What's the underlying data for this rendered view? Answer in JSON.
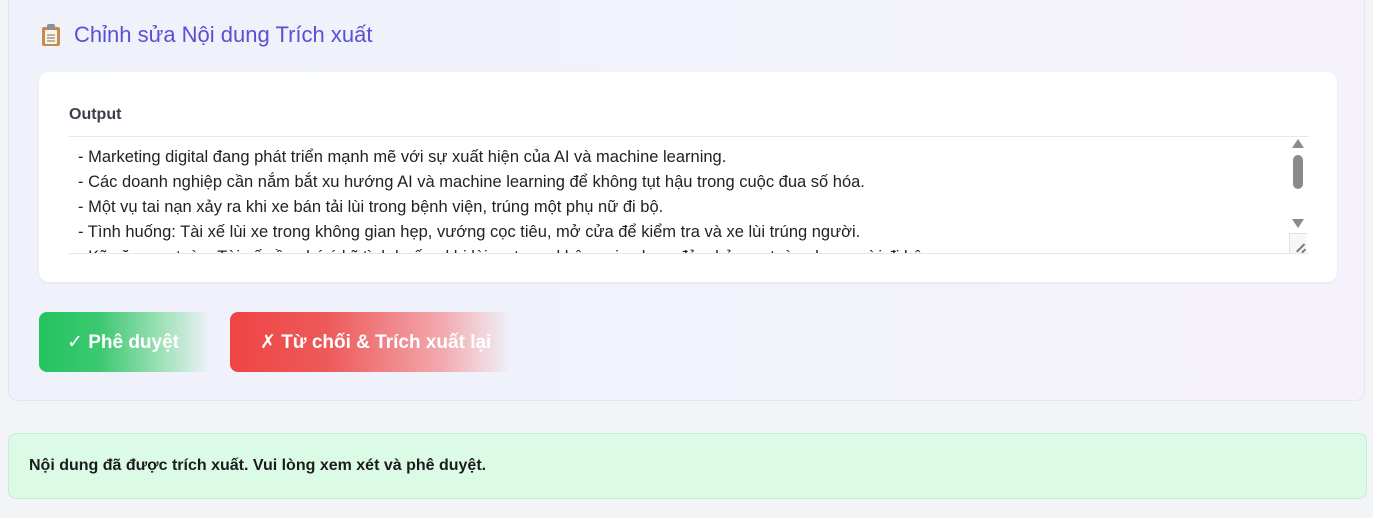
{
  "section": {
    "icon": "clipboard-icon",
    "title": "Chỉnh sửa Nội dung Trích xuất"
  },
  "output": {
    "label": "Output",
    "lines": [
      "- Marketing digital đang phát triển mạnh mẽ với sự xuất hiện của AI và machine learning.",
      "- Các doanh nghiệp cần nắm bắt xu hướng AI và machine learning để không tụt hậu trong cuộc đua số hóa.",
      "- Một vụ tai nạn xảy ra khi xe bán tải lùi trong bệnh viện, trúng một phụ nữ đi bộ.",
      "- Tình huống: Tài xế lùi xe trong không gian hẹp, vướng cọc tiêu, mở cửa để kiểm tra và xe lùi trúng người.",
      "- Kỹ năng an toàn: Tài xế cần chú ý kỹ tình huống khi lùi xe trong không gian hẹp, đảm bảo an toàn cho người đi bộ."
    ]
  },
  "buttons": {
    "approve": "✓ Phê duyệt",
    "reject": "✗ Từ chối & Trích xuất lại"
  },
  "status": {
    "message": "Nội dung đã được trích xuất. Vui lòng xem xét và phê duyệt."
  },
  "colors": {
    "accent": "#5a50d6",
    "approve": "#22c45e",
    "reject": "#ef4444",
    "status_bg": "#dcfbe7"
  }
}
